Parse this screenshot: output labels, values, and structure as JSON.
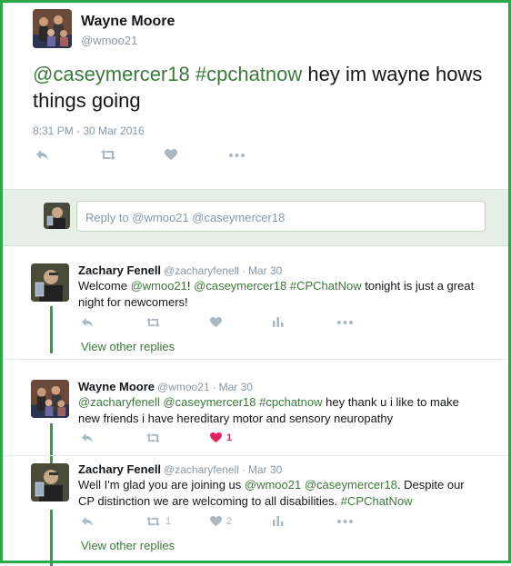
{
  "main_tweet": {
    "name": "Wayne Moore",
    "handle": "@wmoo21",
    "mention1": "@caseymercer18",
    "hashtag": "#cpchatnow",
    "text_rest": " hey im wayne hows things going",
    "timestamp": "8:31 PM - 30 Mar 2016"
  },
  "reply_box": {
    "placeholder": "Reply to @wmoo21 @caseymercer18"
  },
  "replies": [
    {
      "name": "Zachary Fenell",
      "handle": "@zacharyfenell",
      "date": "Mar 30",
      "parts": [
        "Welcome ",
        "@wmoo21",
        "! ",
        "@caseymercer18",
        " ",
        "#CPChatNow",
        " tonight is just a great night for newcomers!"
      ],
      "view_replies": "View other replies"
    },
    {
      "name": "Wayne Moore",
      "handle": "@wmoo21",
      "date": "Mar 30",
      "parts": [
        "@zacharyfenell",
        " ",
        "@caseymercer18",
        " ",
        "#cpchatnow",
        " hey thank u i like to make new friends i have hereditary motor and sensory neuropathy"
      ],
      "like_count": "1"
    },
    {
      "name": "Zachary Fenell",
      "handle": "@zacharyfenell",
      "date": "Mar 30",
      "parts": [
        "Well I'm glad you are joining us ",
        "@wmoo21",
        " ",
        "@caseymercer18",
        ". Despite our CP distinction we are welcoming to all disabilities. ",
        "#CPChatNow"
      ],
      "retweet_count": "1",
      "like_count": "2",
      "view_replies": "View other replies"
    }
  ],
  "colors": {
    "frame": "#2aa84a",
    "link": "#3b7a3b",
    "like_active": "#e0245e"
  },
  "icons": [
    "reply-icon",
    "retweet-icon",
    "like-icon",
    "more-icon",
    "analytics-icon"
  ]
}
